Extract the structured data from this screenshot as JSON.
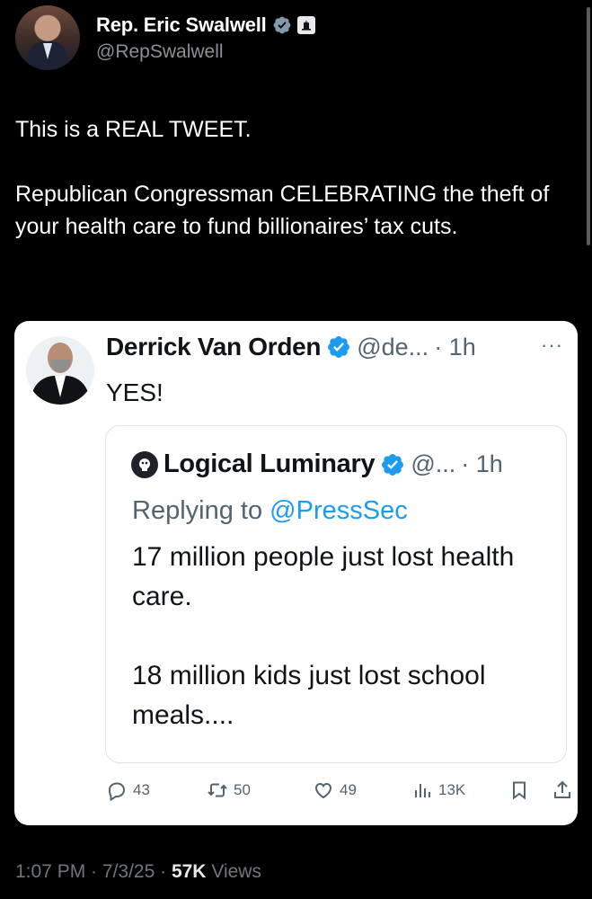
{
  "tweet": {
    "author_name": "Rep. Eric Swalwell",
    "author_handle": "@RepSwalwell",
    "text_line1": "This is a REAL TWEET.",
    "text_line2": "Republican Congressman CELEBRATING the theft of your health care to fund billionaires’ tax cuts.",
    "time": "1:07 PM",
    "separator1": " · ",
    "date": "7/3/25",
    "separator2": " · ",
    "views_count": "57K",
    "views_label": " Views"
  },
  "quote": {
    "author_name": "Derrick Van Orden",
    "author_handle": "@de...",
    "age": "· 1h",
    "more": "···",
    "text": "YES!",
    "nested": {
      "author_name": "Logical Luminary",
      "author_handle": "@...",
      "age": "· 1h",
      "replying_prefix": "Replying to ",
      "replying_to": "@PressSec",
      "text_line1": "17 million people just lost health care.",
      "text_line2": "18 million kids just lost school meals...."
    },
    "actions": {
      "replies": "43",
      "reposts": "50",
      "likes": "49",
      "views": "13K"
    }
  },
  "colors": {
    "background": "#000000",
    "card": "#ffffff",
    "verified": "#1d9bf0",
    "muted": "#536471",
    "link": "#1d9bf0"
  },
  "icons": [
    "verified-icon",
    "government-badge-icon",
    "more-icon",
    "reply-icon",
    "repost-icon",
    "like-icon",
    "views-icon",
    "bookmark-icon",
    "share-icon"
  ]
}
